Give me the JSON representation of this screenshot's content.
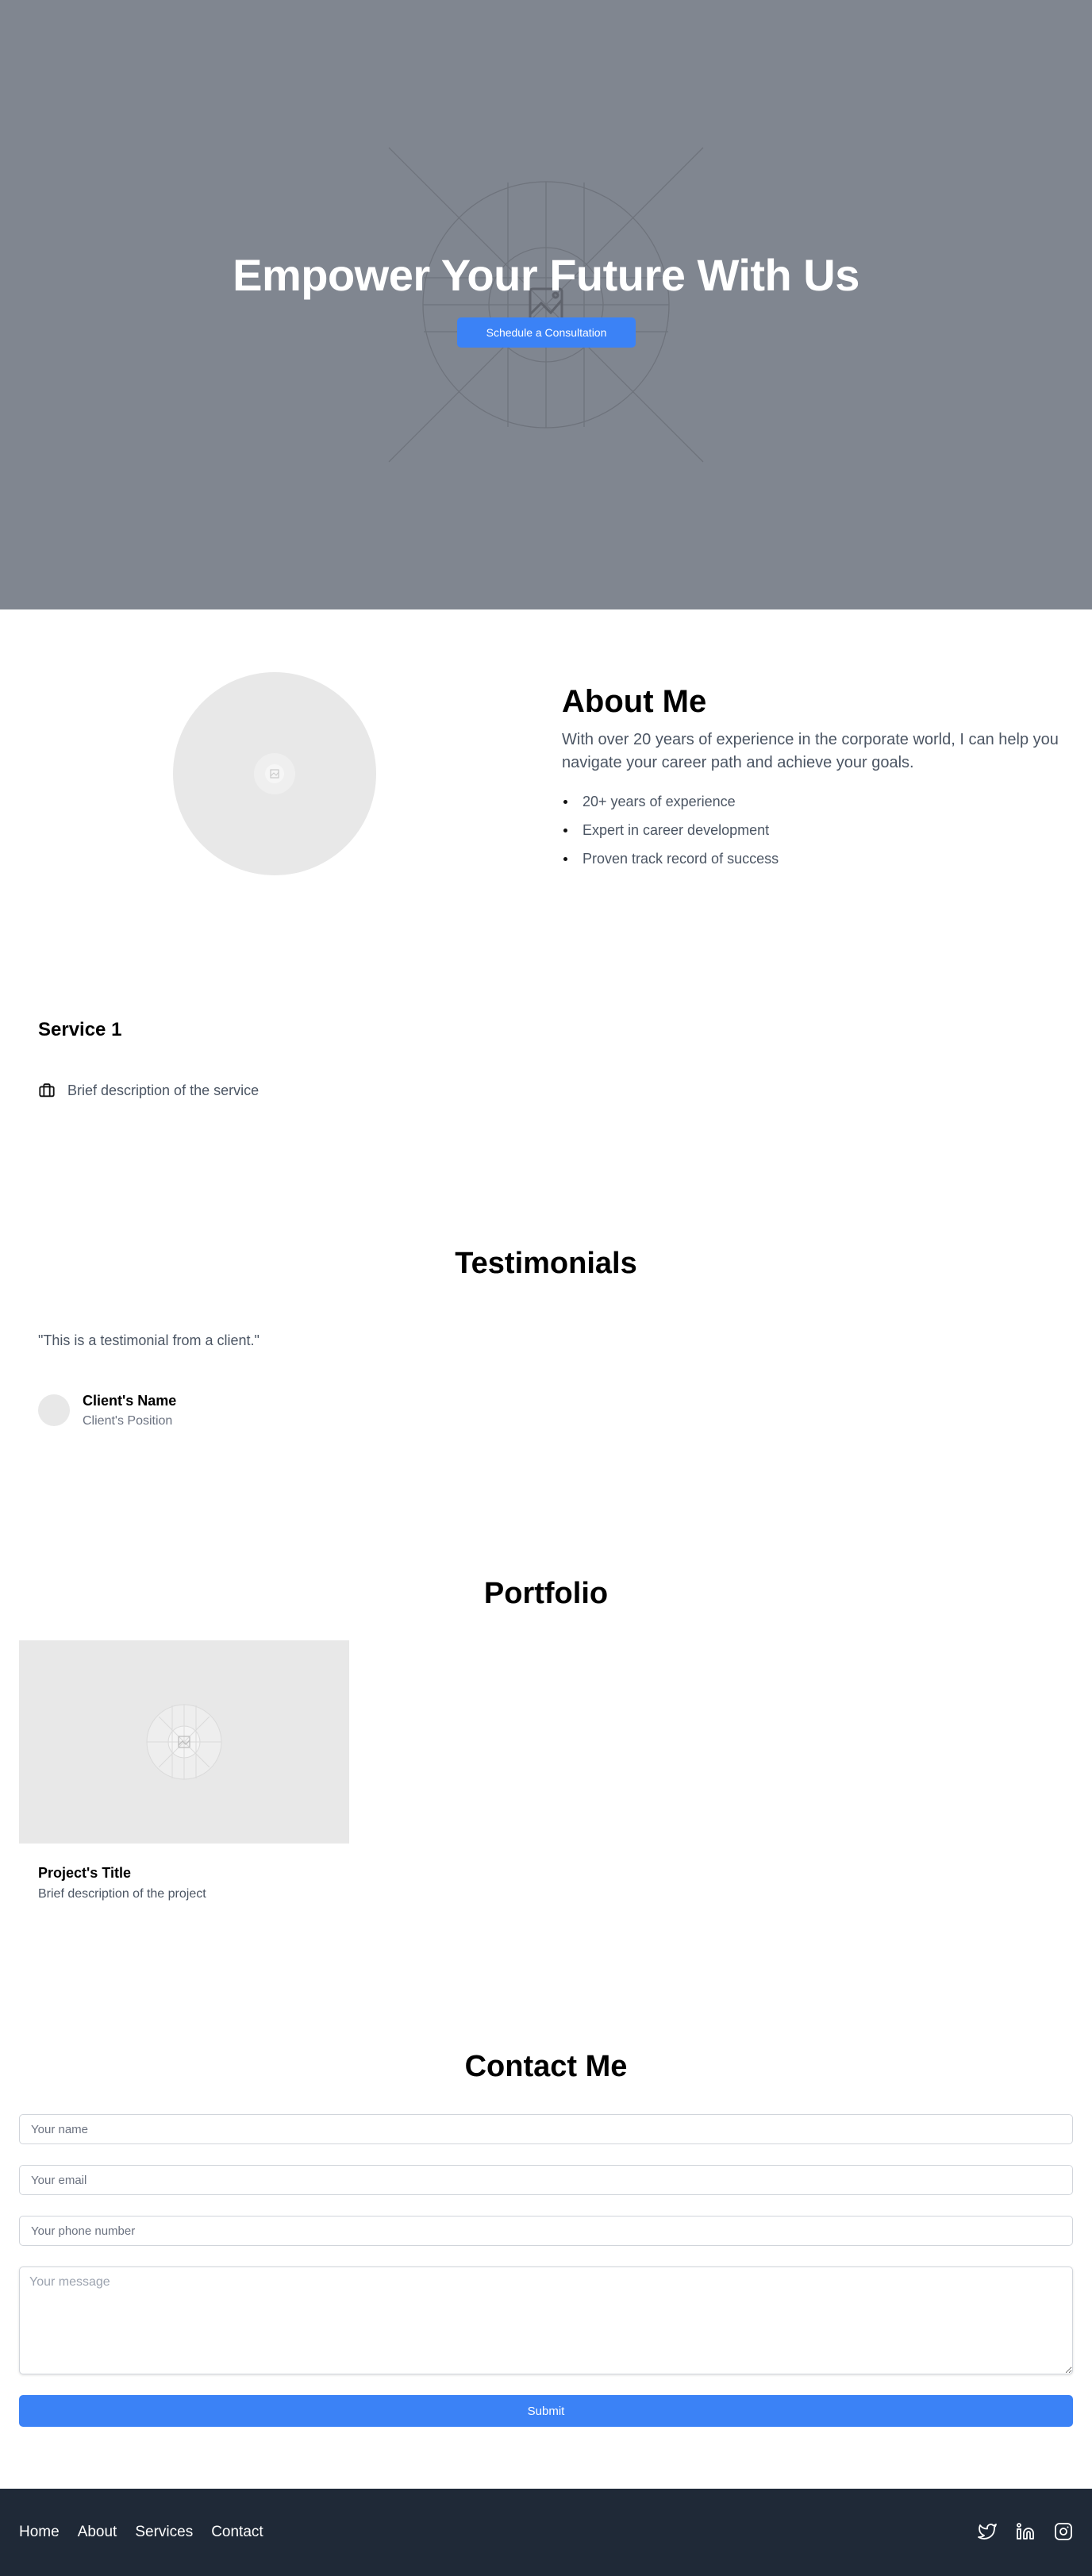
{
  "hero": {
    "title": "Empower Your Future With Us",
    "cta_label": "Schedule a Consultation",
    "background_color": "#808690"
  },
  "about": {
    "title": "About Me",
    "text": "With over 20 years of experience in the corporate world, I can help you navigate your career path and achieve your goals.",
    "highlights": [
      "20+ years of experience",
      "Expert in career development",
      "Proven track record of success"
    ]
  },
  "services": {
    "items": [
      {
        "title": "Service 1",
        "icon": "briefcase-icon",
        "description": "Brief description of the service"
      }
    ]
  },
  "testimonials": {
    "title": "Testimonials",
    "items": [
      {
        "quote": "\"This is a testimonial from a client.\"",
        "name": "Client's Name",
        "position": "Client's Position"
      }
    ]
  },
  "portfolio": {
    "title": "Portfolio",
    "items": [
      {
        "title": "Project's Title",
        "description": "Brief description of the project"
      }
    ]
  },
  "contact": {
    "title": "Contact Me",
    "name_placeholder": "Your name",
    "email_placeholder": "Your email",
    "phone_placeholder": "Your phone number",
    "message_placeholder": "Your message",
    "submit_label": "Submit"
  },
  "footer": {
    "nav": [
      "Home",
      "About",
      "Services",
      "Contact"
    ],
    "social_icons": [
      "twitter-icon",
      "linkedin-icon",
      "instagram-icon"
    ],
    "background_color": "#1f2937"
  },
  "colors": {
    "accent": "#3b82f6",
    "body_text": "#4b5563",
    "placeholder_bg": "#e8e8e8"
  }
}
